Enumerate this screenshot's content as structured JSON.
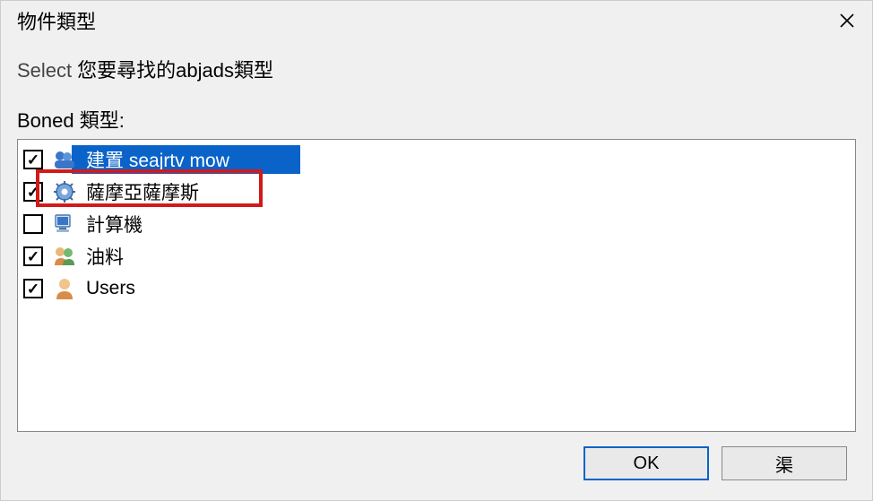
{
  "titlebar": {
    "title": "物件類型"
  },
  "instruction": {
    "select_word": "Select",
    "rest": "您要尋找的abjads類型"
  },
  "section": {
    "label": "Boned 類型:"
  },
  "items": [
    {
      "label": "建置 seajrtv mow",
      "checked": true,
      "icon": "group-icon",
      "selected": true
    },
    {
      "label": "薩摩亞薩摩斯",
      "checked": true,
      "icon": "gear-icon",
      "selected": false,
      "highlighted": true
    },
    {
      "label": "計算機",
      "checked": false,
      "icon": "computer-icon",
      "selected": false
    },
    {
      "label": "油料",
      "checked": true,
      "icon": "users-icon",
      "selected": false
    },
    {
      "label": "Users",
      "checked": true,
      "icon": "user-icon",
      "selected": false
    }
  ],
  "buttons": {
    "ok": "OK",
    "cancel": "渠"
  }
}
